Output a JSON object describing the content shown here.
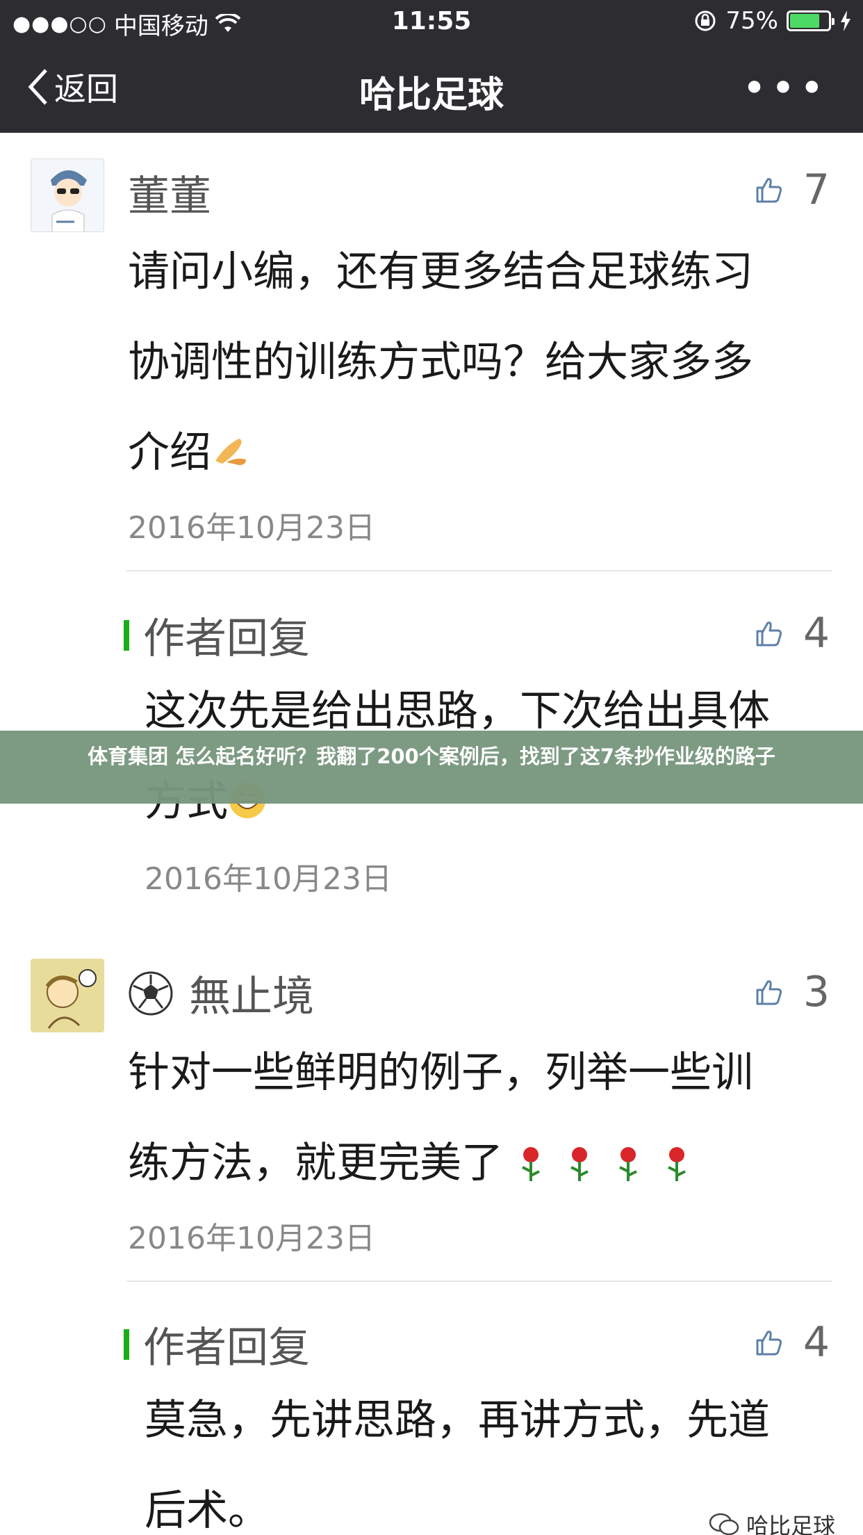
{
  "status_bar": {
    "signal": "●●●○○",
    "carrier": "中国移动",
    "time": "11:55",
    "battery_label": "75%",
    "battery_level": 0.75
  },
  "nav": {
    "back_label": "返回",
    "title": "哈比足球",
    "more_label": "•••"
  },
  "comments": [
    {
      "name": "董董",
      "likes": "7",
      "lines": [
        "请问小编，还有更多结合足球练习",
        "协调性的训练方式吗？给大家多多",
        "介绍"
      ],
      "date": "2016年10月23日",
      "reply": {
        "label": "作者回复",
        "likes": "4",
        "lines": [
          "这次先是给出思路，下次给出具体",
          "方式"
        ],
        "date": "2016年10月23日"
      }
    },
    {
      "name": "無止境",
      "likes": "3",
      "lines": [
        "针对一些鲜明的例子，列举一些训",
        "练方法，就更完美了"
      ],
      "date": "2016年10月23日",
      "reply": {
        "label": "作者回复",
        "likes": "4",
        "lines": [
          "莫急，先讲思路，再讲方式，先道",
          "后术。"
        ]
      }
    }
  ],
  "banner_text": "体育集团 怎么起名好听？我翻了200个案例后，找到了这7条抄作业级的路子",
  "watermark": "哈比足球",
  "colors": {
    "nav_bg": "#2d2d31",
    "reply_bar": "#1aad19",
    "banner_bg": "#78967d",
    "battery": "#4cd964"
  }
}
